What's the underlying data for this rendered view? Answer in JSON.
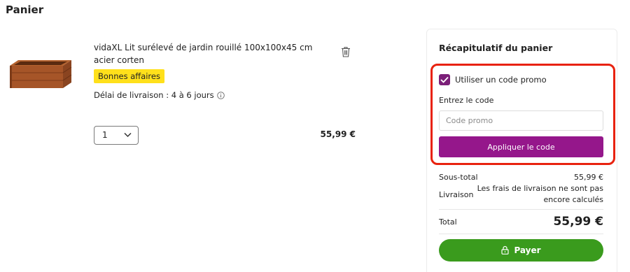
{
  "page": {
    "title": "Panier"
  },
  "item": {
    "name": "vidaXL Lit surélevé de jardin rouillé 100x100x45 cm acier corten",
    "badge": "Bonnes affaires",
    "delivery": "Délai de livraison : 4 à 6 jours",
    "quantity": "1",
    "price": "55,99 €",
    "icons": {
      "delete": "trash-icon",
      "info": "info-icon",
      "quantity": "chevron-down-icon"
    }
  },
  "summary": {
    "title": "Récapitulatif du panier",
    "promo": {
      "checkbox_label": "Utiliser un code promo",
      "checked": true,
      "code_label": "Entrez le code",
      "placeholder": "Code promo",
      "value": "",
      "apply_label": "Appliquer le code"
    },
    "subtotal_label": "Sous-total",
    "subtotal_value": "55,99 €",
    "shipping_label": "Livraison",
    "shipping_value": "Les frais de livraison ne sont pas encore calculés",
    "total_label": "Total",
    "total_value": "55,99 €",
    "pay_label": "Payer",
    "icons": {
      "pay": "lock-icon",
      "checkbox": "checkmark-icon"
    }
  },
  "colors": {
    "badge": "#ffe01b",
    "promo_button": "#95178b",
    "checkbox": "#7b1f78",
    "pay_button": "#3a9b1d",
    "highlight_border": "#e8220f"
  }
}
